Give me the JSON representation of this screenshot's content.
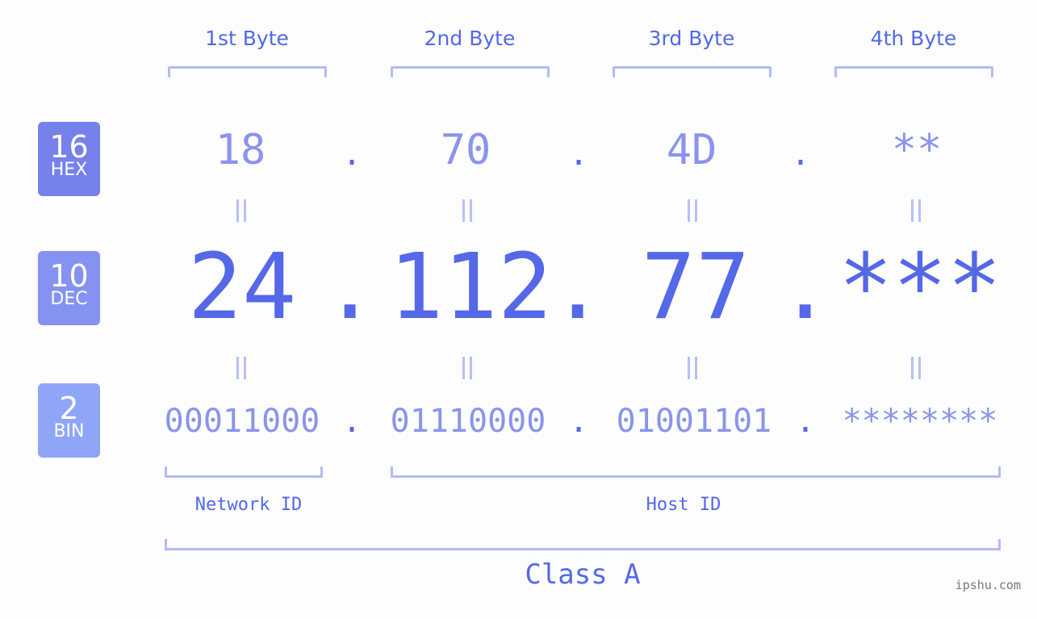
{
  "bytes": [
    {
      "label": "1st Byte",
      "hex": "18",
      "dec": "24",
      "bin": "00011000"
    },
    {
      "label": "2nd Byte",
      "hex": "70",
      "dec": "112",
      "bin": "01110000"
    },
    {
      "label": "3rd Byte",
      "hex": "4D",
      "dec": "77",
      "bin": "01001101"
    },
    {
      "label": "4th Byte",
      "hex": "**",
      "dec": "***",
      "bin": "********"
    }
  ],
  "separator": ".",
  "badges": {
    "hex": {
      "num": "16",
      "label": "HEX",
      "color": "#7681eb"
    },
    "dec": {
      "num": "10",
      "label": "DEC",
      "color": "#8592f2"
    },
    "bin": {
      "num": "2",
      "label": "BIN",
      "color": "#8fa5f7"
    }
  },
  "network_id_label": "Network ID",
  "host_id_label": "Host ID",
  "class_label": "Class A",
  "watermark": "ipshu.com",
  "colors": {
    "primary": "#5468e8",
    "secondary": "#8a94ec",
    "bracket": "#b3bbf7"
  }
}
